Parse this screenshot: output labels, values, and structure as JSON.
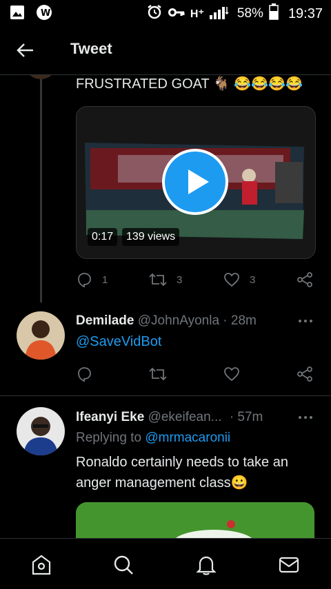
{
  "status_bar": {
    "network_type": "H⁺",
    "battery_percent": "58%",
    "time": "19:37",
    "icons": [
      "gallery-icon",
      "app-notification-icon",
      "alarm-icon",
      "vpn-key-icon",
      "signal-icon",
      "battery-icon"
    ]
  },
  "app_bar": {
    "title": "Tweet",
    "back_icon": "arrow-left-icon"
  },
  "tweet_parent": {
    "text": "FRUSTRATED GOAT 🐐 😂😂😂😂",
    "video": {
      "duration": "0:17",
      "views": "139 views",
      "play_icon": "play-icon"
    },
    "actions": {
      "reply_count": "1",
      "retweet_count": "3",
      "like_count": "3"
    }
  },
  "reply_1": {
    "name": "Demilade",
    "handle": "@JohnAyonla",
    "separator": "·",
    "time": "28m",
    "text": "@SaveVidBot"
  },
  "reply_2": {
    "name": "Ifeanyi Eke",
    "handle": "@ekeifean...",
    "separator": "·",
    "time": "57m",
    "replying_to_label": "Replying to",
    "replying_to_handle": "@mrmacaronii",
    "text": "Ronaldo certainly needs to take an anger management class😀"
  },
  "bottom_nav": {
    "items": [
      "home-icon",
      "search-icon",
      "notifications-icon",
      "messages-icon"
    ]
  },
  "colors": {
    "background": "#000000",
    "accent": "#1d9bf0",
    "muted": "#71767b",
    "text": "#e7e9ea",
    "divider": "#2f3336"
  }
}
